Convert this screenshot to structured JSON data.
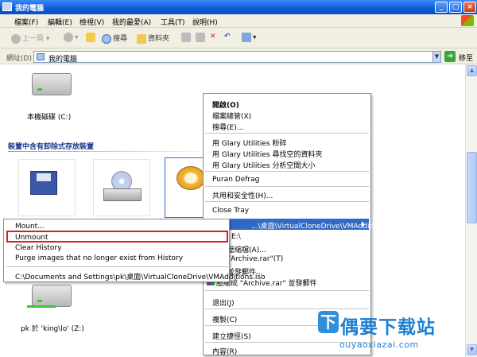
{
  "window": {
    "title": "我的電腦",
    "controls": {
      "minimize": "_",
      "maximize": "□",
      "close": "×"
    }
  },
  "menubar": {
    "items": [
      "檔案(F)",
      "編輯(E)",
      "檢視(V)",
      "我的最愛(A)",
      "工具(T)",
      "說明(H)"
    ]
  },
  "toolbar": {
    "back": "上一頁",
    "search": "搜尋",
    "folders": "資料夾"
  },
  "address": {
    "label": "網址(D)",
    "value": "我的電腦",
    "go": "移至"
  },
  "content": {
    "local_drive_label": "本機磁碟 (C:)",
    "removable_section_title": "裝置中含有卸除式存放裝置",
    "network_drive_label": "pk 於 'king\\lo' (Z:)"
  },
  "context_menu": {
    "items": {
      "open": "開啟(O)",
      "explore": "檔案總管(X)",
      "search": "搜尋(E)...",
      "glary_shred": "用 Glary Utilities 粉碎",
      "glary_empty": "用 Glary Utilities 尋找空的資料夾",
      "glary_analyze": "用 Glary Utilities 分析空間大小",
      "puran": "Puran Defrag",
      "sharing": "共用和安全性(H)...",
      "close_tray": "Close Tray",
      "vcd_path": "...\\桌面\\VirtualCloneDrive\\VMAdditions.iso)",
      "partial_1": "E:\\",
      "partial_2": "壓縮檔(A)...",
      "partial_3": "\"Archive.rar\"(T)",
      "partial_4": "並發郵件...",
      "compress_email": "壓縮成 \"Archive.rar\" 並發郵件",
      "eject": "退出(J)",
      "copy": "複製(C)",
      "shortcut": "建立捷徑(S)",
      "properties": "內容(R)"
    }
  },
  "submenu": {
    "items": [
      "Mount...",
      "Unmount",
      "Clear History",
      "Purge images that no longer exist from History"
    ],
    "history_entry": "C:\\Documents and Settings\\pk\\桌面\\VirtualCloneDrive\\VMAdditions.iso"
  },
  "watermark": {
    "title": "偶要下载站",
    "url": "ouyaoxiazai.com"
  }
}
